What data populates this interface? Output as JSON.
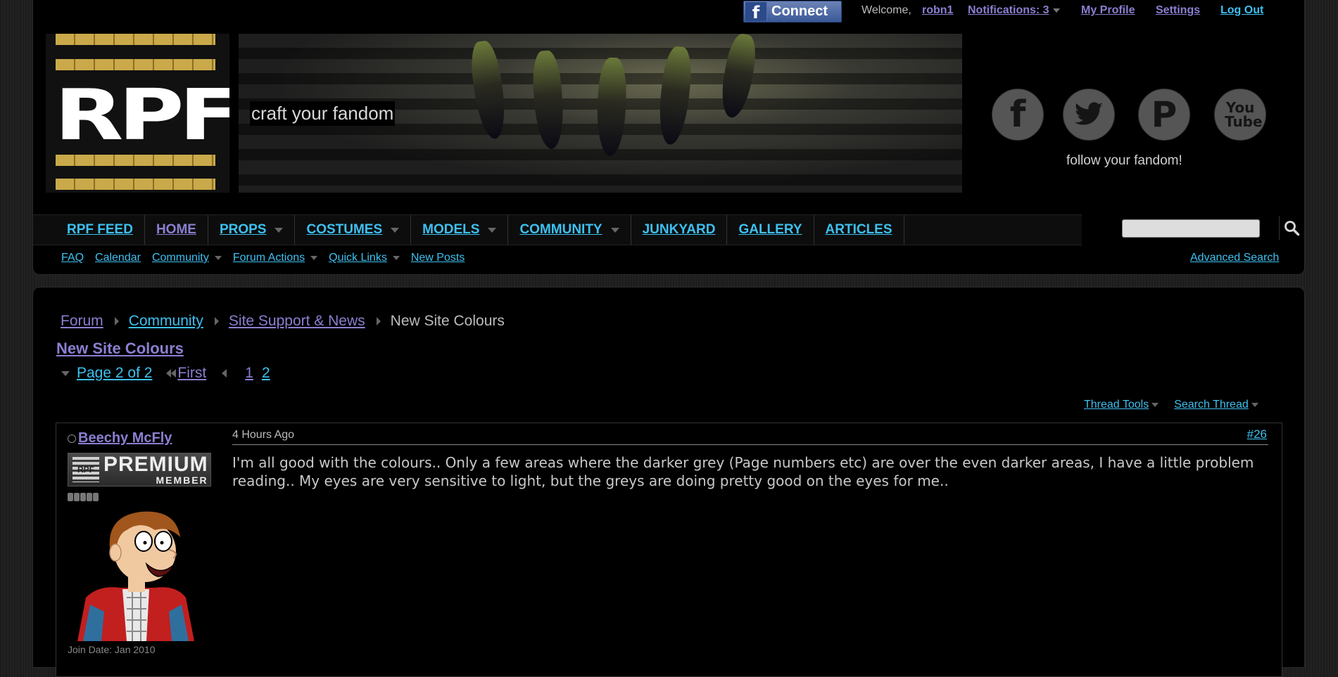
{
  "toplinks": {
    "fb_connect": "Connect",
    "welcome": "Welcome,",
    "username": "robn1",
    "notifications": "Notifications: 3",
    "my_profile": "My Profile",
    "settings": "Settings",
    "log_out": "Log Out"
  },
  "logo": {
    "text": "RPF"
  },
  "banner": {
    "tagline": "craft your fandom"
  },
  "social": {
    "facebook_glyph": "f",
    "twitter_glyph": "t",
    "pinterest_glyph": "P",
    "youtube_glyph": "You Tube",
    "follow": "follow your fandom!"
  },
  "nav": {
    "items": [
      {
        "label": "RPF FEED",
        "dropdown": false
      },
      {
        "label": "HOME",
        "dropdown": false
      },
      {
        "label": "PROPS",
        "dropdown": true
      },
      {
        "label": "COSTUMES",
        "dropdown": true
      },
      {
        "label": "MODELS",
        "dropdown": true
      },
      {
        "label": "COMMUNITY",
        "dropdown": true
      },
      {
        "label": "JUNKYARD",
        "dropdown": false
      },
      {
        "label": "GALLERY",
        "dropdown": false
      },
      {
        "label": "ARTICLES",
        "dropdown": false
      }
    ]
  },
  "subnav": {
    "items": [
      {
        "label": "FAQ",
        "dropdown": false
      },
      {
        "label": "Calendar",
        "dropdown": false
      },
      {
        "label": "Community",
        "dropdown": true
      },
      {
        "label": "Forum Actions",
        "dropdown": true
      },
      {
        "label": "Quick Links",
        "dropdown": true
      },
      {
        "label": "New Posts",
        "dropdown": false
      }
    ],
    "advanced_search": "Advanced Search"
  },
  "breadcrumb": {
    "forum": "Forum",
    "community": "Community",
    "section": "Site Support & News",
    "current": "New Site Colours"
  },
  "thread": {
    "title": "New Site Colours",
    "page_of": "Page 2 of 2",
    "first": "First",
    "page1": "1",
    "page2": "2",
    "thread_tools": "Thread Tools",
    "search_thread": "Search Thread"
  },
  "post": {
    "username": "Beechy McFly",
    "badge_logo": "RPF",
    "badge_line1": "PREMIUM",
    "badge_line2": "MEMBER",
    "join_date": "Join Date: Jan 2010",
    "date": "4 Hours Ago",
    "number": "#26",
    "text": "I'm all good with the colours.. Only a few areas where the darker grey (Page numbers etc) are over the even darker areas, I have a little problem reading.. My eyes are very sensitive to light, but the greys are doing pretty good on the eyes for me.."
  },
  "colors": {
    "link": "#3ec0f0",
    "visited": "#8a7fd0",
    "background": "#000000"
  }
}
